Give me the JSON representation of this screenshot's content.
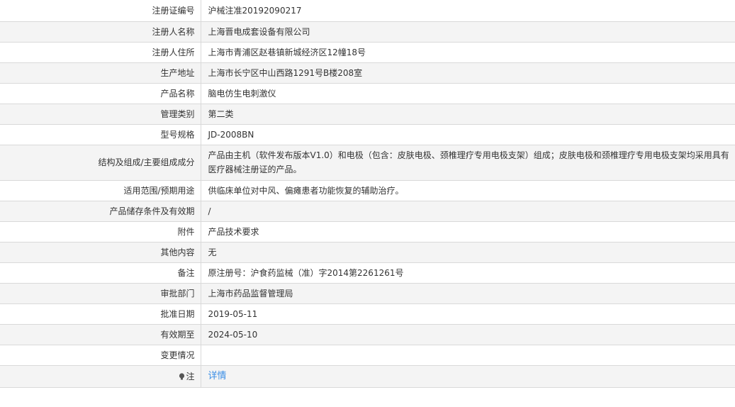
{
  "rows": [
    {
      "label": "注册证编号",
      "value": "沪械注准20192090217"
    },
    {
      "label": "注册人名称",
      "value": "上海晋电成套设备有限公司"
    },
    {
      "label": "注册人住所",
      "value": "上海市青浦区赵巷镇新城经济区12幢18号"
    },
    {
      "label": "生产地址",
      "value": "上海市长宁区中山西路1291号B楼208室"
    },
    {
      "label": "产品名称",
      "value": "脑电仿生电刺激仪"
    },
    {
      "label": "管理类别",
      "value": "第二类"
    },
    {
      "label": "型号规格",
      "value": "JD-2008BN"
    },
    {
      "label": "结构及组成/主要组成成分",
      "value": "产品由主机（软件发布版本V1.0）和电极（包含：皮肤电极、颈椎理疗专用电极支架）组成；皮肤电极和颈椎理疗专用电极支架均采用具有医疗器械注册证的产品。"
    },
    {
      "label": "适用范围/预期用途",
      "value": "供临床单位对中风、偏瘫患者功能恢复的辅助治疗。"
    },
    {
      "label": "产品储存条件及有效期",
      "value": "/"
    },
    {
      "label": "附件",
      "value": "产品技术要求"
    },
    {
      "label": "其他内容",
      "value": "无"
    },
    {
      "label": "备注",
      "value": "原注册号：沪食药监械（准）字2014第2261261号"
    },
    {
      "label": "审批部门",
      "value": "上海市药品监督管理局"
    },
    {
      "label": "批准日期",
      "value": "2019-05-11"
    },
    {
      "label": "有效期至",
      "value": "2024-05-10"
    },
    {
      "label": "变更情况",
      "value": ""
    }
  ],
  "note": {
    "label": "注",
    "icon": "lightbulb-icon",
    "link_text": "详情",
    "link_color": "#3a8ee6"
  }
}
